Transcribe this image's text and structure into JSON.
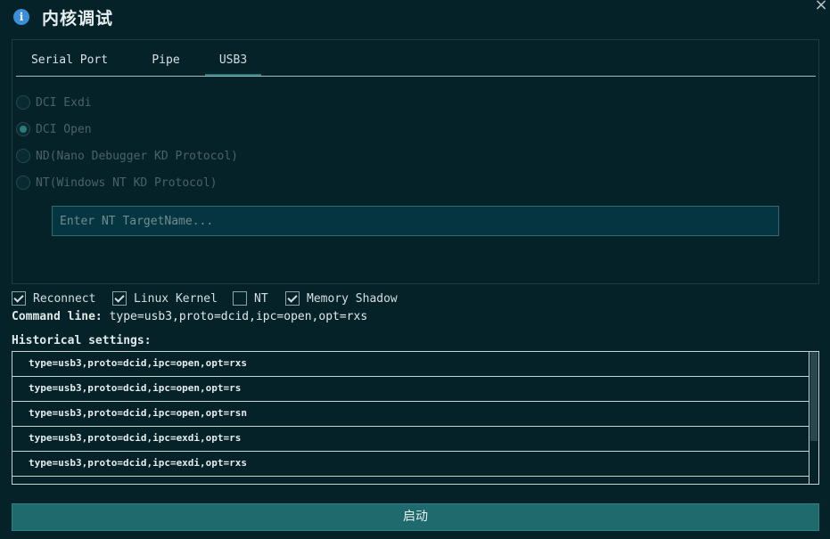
{
  "window": {
    "title": "内核调试",
    "info_icon": "info-icon",
    "close_icon": "×"
  },
  "tabs": [
    {
      "label": "Serial Port",
      "active": false
    },
    {
      "label": "Pipe",
      "active": false
    },
    {
      "label": "USB3",
      "active": true
    }
  ],
  "protocols": [
    {
      "label": "DCI Exdi",
      "checked": false
    },
    {
      "label": "DCI Open",
      "checked": true
    },
    {
      "label": "ND(Nano Debugger KD Protocol)",
      "checked": false
    },
    {
      "label": "NT(Windows NT KD Protocol)",
      "checked": false
    }
  ],
  "target_name": {
    "value": "",
    "placeholder": "Enter NT TargetName..."
  },
  "options": [
    {
      "label": "Reconnect",
      "checked": true
    },
    {
      "label": "Linux Kernel",
      "checked": true
    },
    {
      "label": "NT",
      "checked": false
    },
    {
      "label": "Memory Shadow",
      "checked": true
    }
  ],
  "command_line": {
    "label": "Command line:",
    "value": "type=usb3,proto=dcid,ipc=open,opt=rxs"
  },
  "history": {
    "label": "Historical settings:",
    "items": [
      "type=usb3,proto=dcid,ipc=open,opt=rxs",
      "type=usb3,proto=dcid,ipc=open,opt=rs",
      "type=usb3,proto=dcid,ipc=open,opt=rsn",
      "type=usb3,proto=dcid,ipc=exdi,opt=rs",
      "type=usb3,proto=dcid,ipc=exdi,opt=rxs"
    ]
  },
  "start_button": {
    "label": "启动"
  },
  "colors": {
    "background": "#062229",
    "accent": "#1e6a6c",
    "input_bg": "#053540"
  }
}
